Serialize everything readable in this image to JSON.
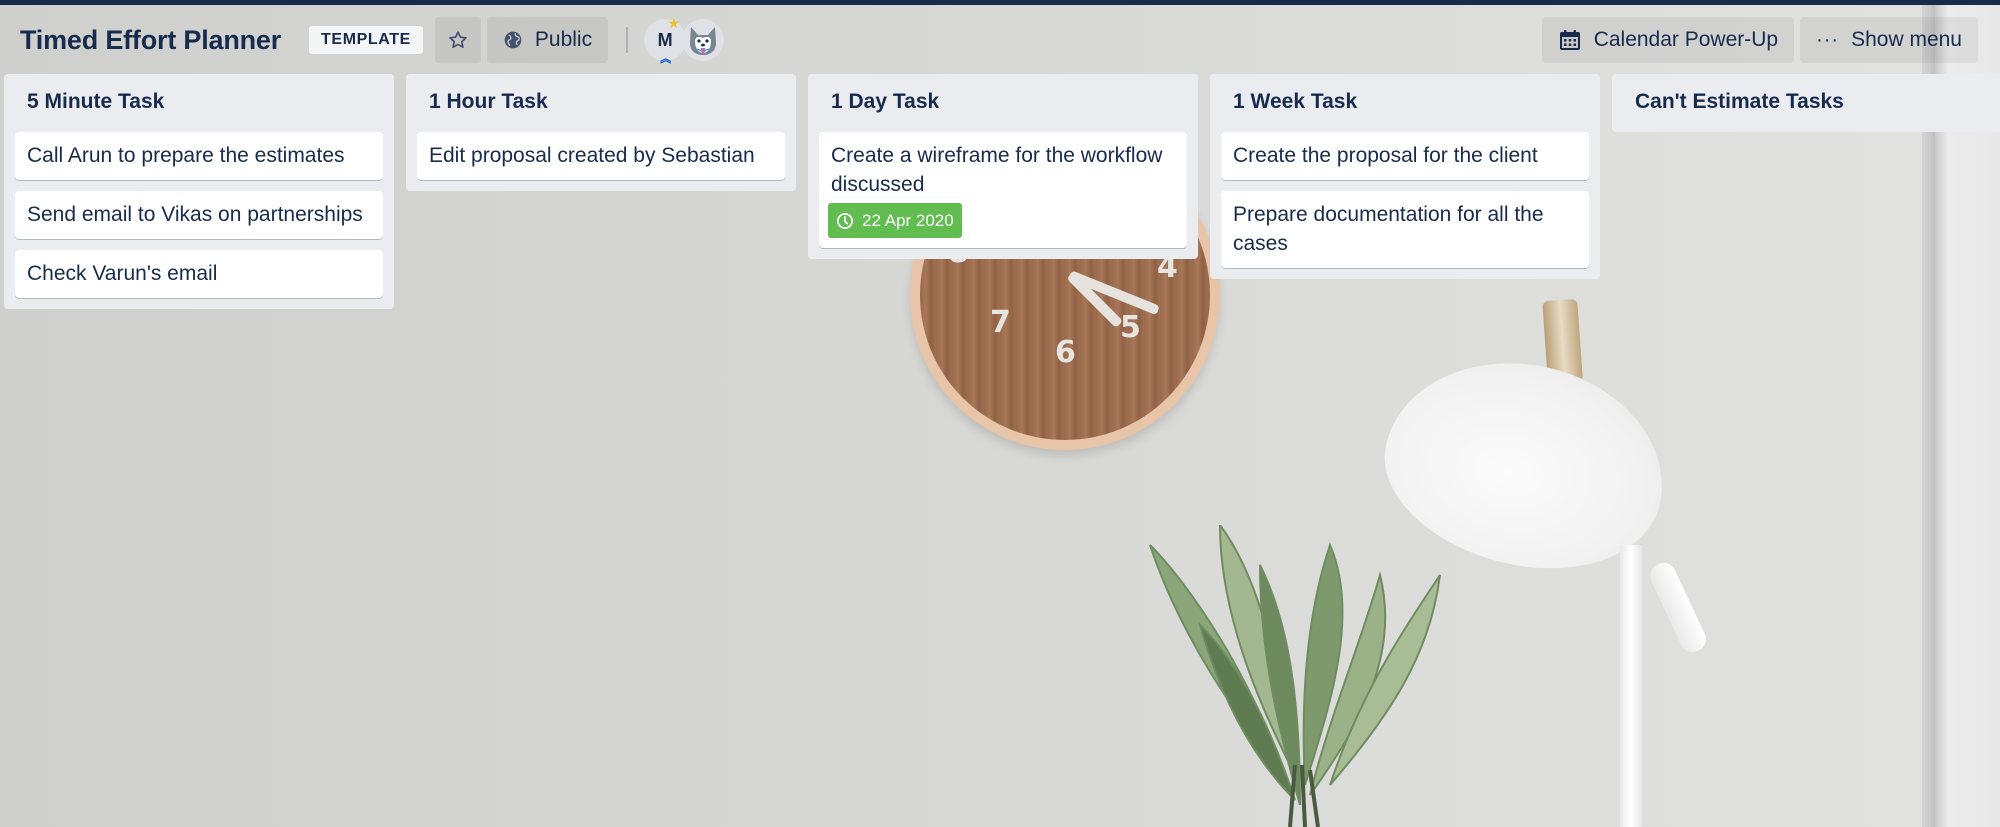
{
  "board": {
    "title": "Timed Effort Planner",
    "template_badge": "TEMPLATE",
    "visibility": "Public",
    "star_icon": "star-icon",
    "members": [
      {
        "initials": "M",
        "role": "admin"
      },
      {
        "initials": "",
        "avatar": "husky-avatar"
      }
    ]
  },
  "header_right": {
    "calendar_label": "Calendar Power-Up",
    "menu_label": "Show menu"
  },
  "lists": [
    {
      "title": "5 Minute Task",
      "cards": [
        {
          "title": "Call Arun to prepare the estimates"
        },
        {
          "title": "Send email to Vikas on partnerships"
        },
        {
          "title": "Check Varun's email"
        }
      ]
    },
    {
      "title": "1 Hour Task",
      "cards": [
        {
          "title": "Edit proposal created by Sebastian"
        }
      ]
    },
    {
      "title": "1 Day Task",
      "cards": [
        {
          "title": "Create a wireframe for the workflow discussed",
          "due": "22 Apr 2020",
          "due_color": "#61bd4f"
        }
      ]
    },
    {
      "title": "1 Week Task",
      "cards": [
        {
          "title": "Create the proposal for the client"
        },
        {
          "title": "Prepare documentation for all the cases"
        }
      ]
    },
    {
      "title": "Can't Estimate Tasks",
      "cards": []
    }
  ],
  "colors": {
    "header_stripe": "#172b4d",
    "text": "#172b4d",
    "list_bg": "#ebecf0",
    "due_badge": "#61bd4f"
  }
}
